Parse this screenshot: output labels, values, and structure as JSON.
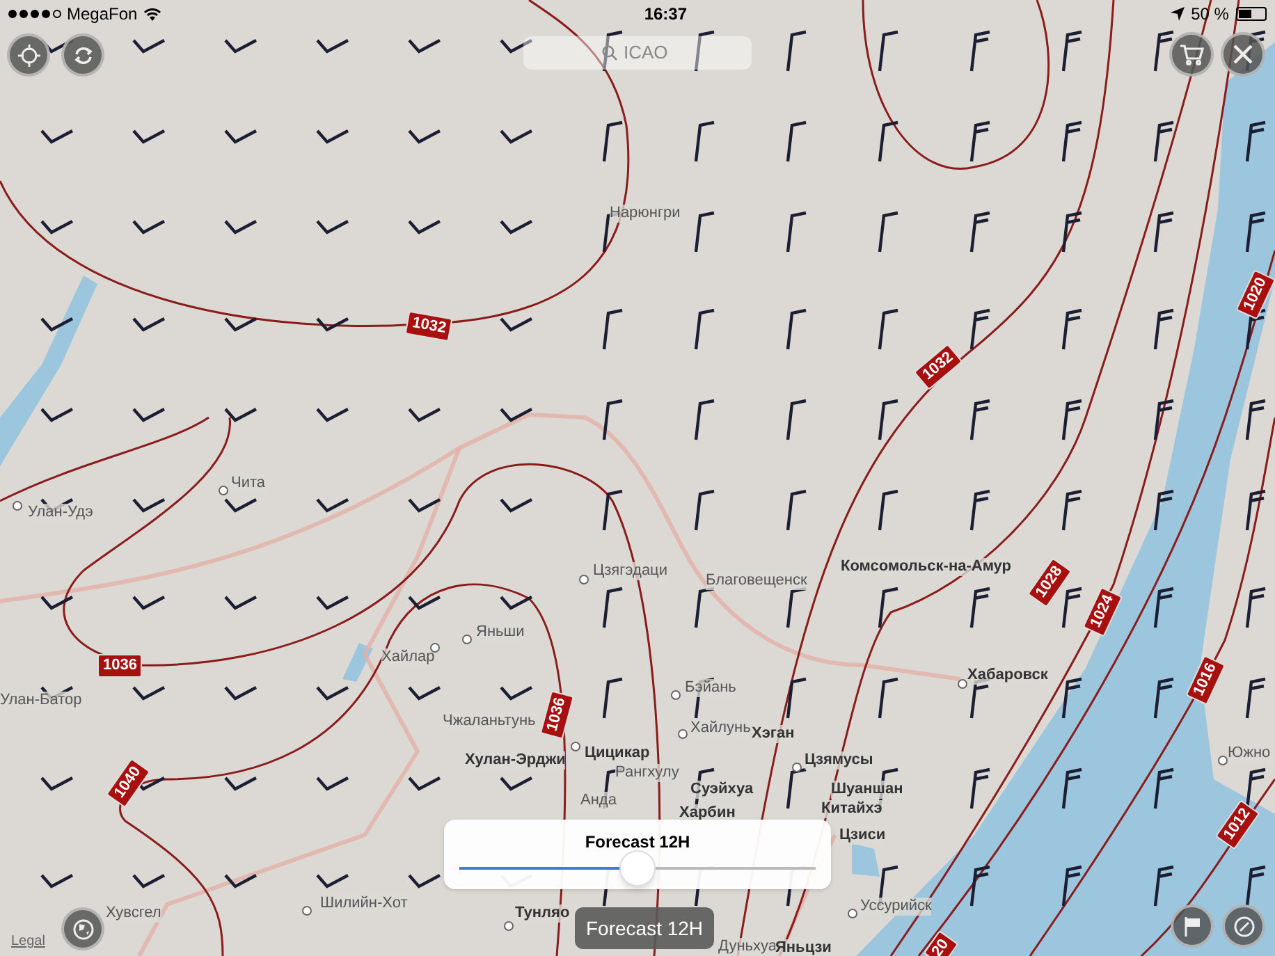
{
  "status_bar": {
    "signal_dots": [
      true,
      true,
      true,
      true,
      false
    ],
    "carrier": "MegaFon",
    "time": "16:37",
    "battery": "50 %"
  },
  "search": {
    "placeholder": "ICAO"
  },
  "cities": [
    {
      "name": "Нарюнгри"
    },
    {
      "name": "Чита"
    },
    {
      "name": "Улан-Удэ"
    },
    {
      "name": "Цзягэдаци"
    },
    {
      "name": "Благовещенск"
    },
    {
      "name": "Комсомольск-на-Амур"
    },
    {
      "name": "Хайлар"
    },
    {
      "name": "Яньши"
    },
    {
      "name": "Улан-Батор"
    },
    {
      "name": "Чжаланьтунь"
    },
    {
      "name": "Хулан-Эрджи"
    },
    {
      "name": "Цицикар"
    },
    {
      "name": "Рангхулу"
    },
    {
      "name": "Бэйань"
    },
    {
      "name": "Хабаровск"
    },
    {
      "name": "Хайлунь"
    },
    {
      "name": "Хэган"
    },
    {
      "name": "Цзямусы"
    },
    {
      "name": "Анда"
    },
    {
      "name": "Суэйхуа"
    },
    {
      "name": "Шуаншан"
    },
    {
      "name": "Харбин"
    },
    {
      "name": "Китайхэ"
    },
    {
      "name": "Южно"
    },
    {
      "name": "Цзиси"
    },
    {
      "name": "Хувсгел"
    },
    {
      "name": "Шилийн-Хот"
    },
    {
      "name": "Тунляо"
    },
    {
      "name": "Уссурийск"
    },
    {
      "name": "Дуньхуа"
    },
    {
      "name": "Яньцзи"
    }
  ],
  "isobar_labels": [
    "1032",
    "1032",
    "1036",
    "1036",
    "1040",
    "1028",
    "1024",
    "1020",
    "1016",
    "1012",
    "20"
  ],
  "forecast": {
    "title": "Forecast 12H",
    "level": 0.5,
    "tooltip": "Forecast 12H"
  },
  "legal": "Legal"
}
